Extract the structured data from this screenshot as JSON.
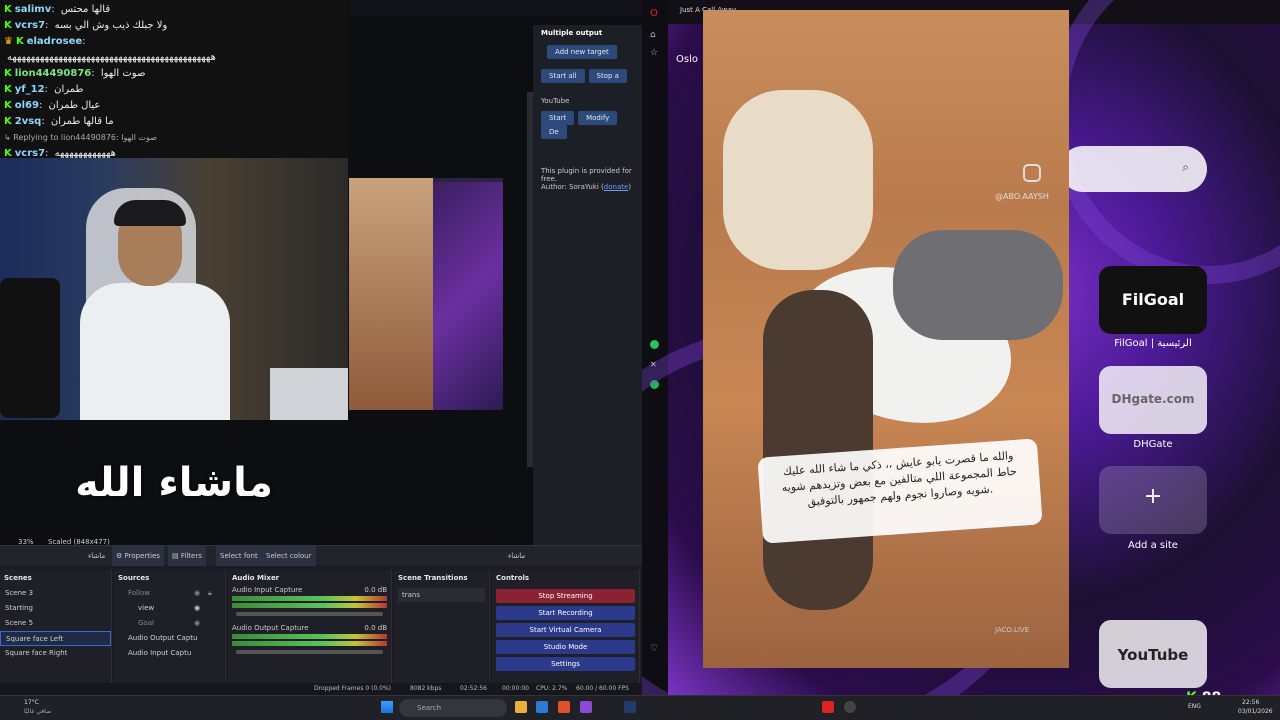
{
  "chat": [
    {
      "user": "salimv",
      "msg": "قالها محتس"
    },
    {
      "user": "vcrs7",
      "msg": "ولا جبلك ذيب وش الي بسه"
    },
    {
      "user": "eladrosee",
      "msg": ""
    },
    {
      "user": "",
      "msg": "ههههههههههههههههههههههههههههههههههههههههههههه"
    },
    {
      "user": "lion44490876",
      "msg": "صوت الهوا"
    },
    {
      "user": "yf_12",
      "msg": "طمران"
    },
    {
      "user": "ol69",
      "msg": "عيال طمران"
    },
    {
      "user": "2vsq",
      "msg": "ما قالها طمران"
    },
    {
      "user": "Replying to lion44490876",
      "msg": "صوت الهوا"
    },
    {
      "user": "vcrs7",
      "msg": "ههههههههههههه"
    }
  ],
  "overlay_text": "ماشاء الله",
  "multi_output": {
    "title": "Multiple output",
    "add_target": "Add new target",
    "start_all": "Start all",
    "stop_all": "Stop a",
    "target_name": "YouTube",
    "start": "Start",
    "modify": "Modify",
    "delete": "De",
    "note": "This plugin is provided for free.",
    "author_prefix": "Author: SoraYuki (",
    "donate": "donate",
    "author_suffix": ")"
  },
  "obs_toolbar": {
    "zoom": "33%",
    "scaled": "Scaled (848x477)",
    "source_name": "ماشاء",
    "properties": "Properties",
    "filters": "Filters",
    "select_font": "Select font",
    "select_colour": "Select colour",
    "right_name": "ماشاء"
  },
  "scenes": {
    "title": "Scenes",
    "items": [
      "Scene 3",
      "Starting",
      "Scene 5",
      "Square face Left",
      "Square face Right"
    ],
    "selected": "Square face Left"
  },
  "sources": {
    "title": "Sources",
    "items": [
      "Follow",
      "view",
      "Goal",
      "Audio Output Captu",
      "Audio Input Captu"
    ]
  },
  "audio_mixer": {
    "title": "Audio Mixer",
    "channels": [
      {
        "name": "Audio Input Capture",
        "db": "0.0 dB",
        "level": 0.7
      },
      {
        "name": "Audio Output Capture",
        "db": "0.0 dB",
        "level": 0.85
      }
    ],
    "scale": [
      "-60",
      "-55",
      "-50",
      "-45",
      "-40",
      "-35",
      "-30",
      "-25",
      "-20",
      "-15",
      "-10",
      "-5",
      "0"
    ]
  },
  "scene_transitions": {
    "title": "Scene Transitions",
    "selected": "trans"
  },
  "controls": {
    "title": "Controls",
    "stop_streaming": "Stop Streaming",
    "start_recording": "Start Recording",
    "start_virtual_camera": "Start Virtual Camera",
    "studio_mode": "Studio Mode",
    "settings": "Settings"
  },
  "status": {
    "dropped": "Dropped Frames 0 (0.0%)",
    "kbps": "8082 kbps",
    "live_time": "02:52:56",
    "rec_time": "00:00:00",
    "cpu": "CPU: 2.7%",
    "fps": "60.00 / 60.00 FPS"
  },
  "browser": {
    "tab1": "Just A Call Away",
    "location": "Oslo",
    "tiles": [
      {
        "label": "FilGoal | الرئيسية",
        "logo": "FilGoal"
      },
      {
        "label": "DHGate",
        "logo": "DHgate.com"
      },
      {
        "label": "Add a site",
        "logo": "+"
      },
      {
        "label": "",
        "logo": "YouTube"
      }
    ]
  },
  "video": {
    "handle": "@ABO.AAYSH",
    "watermark": "JACO.LIVE",
    "caption_lines": [
      "والله ما قصرت يابو عايش ،، ذكي ما شاء الله عليك",
      "حاط المجموعة اللي متالفين مع بعض وتزيدهم شويه",
      "شويه وصاروا نجوم ولهم جمهور بالتوفيق."
    ]
  },
  "kick_counter": "88",
  "taskbar": {
    "weather_temp": "17°C",
    "weather_desc": "صافي غالبًا",
    "search": "Search",
    "lang": "ENG",
    "time": "22:56",
    "date": "03/01/2026"
  }
}
